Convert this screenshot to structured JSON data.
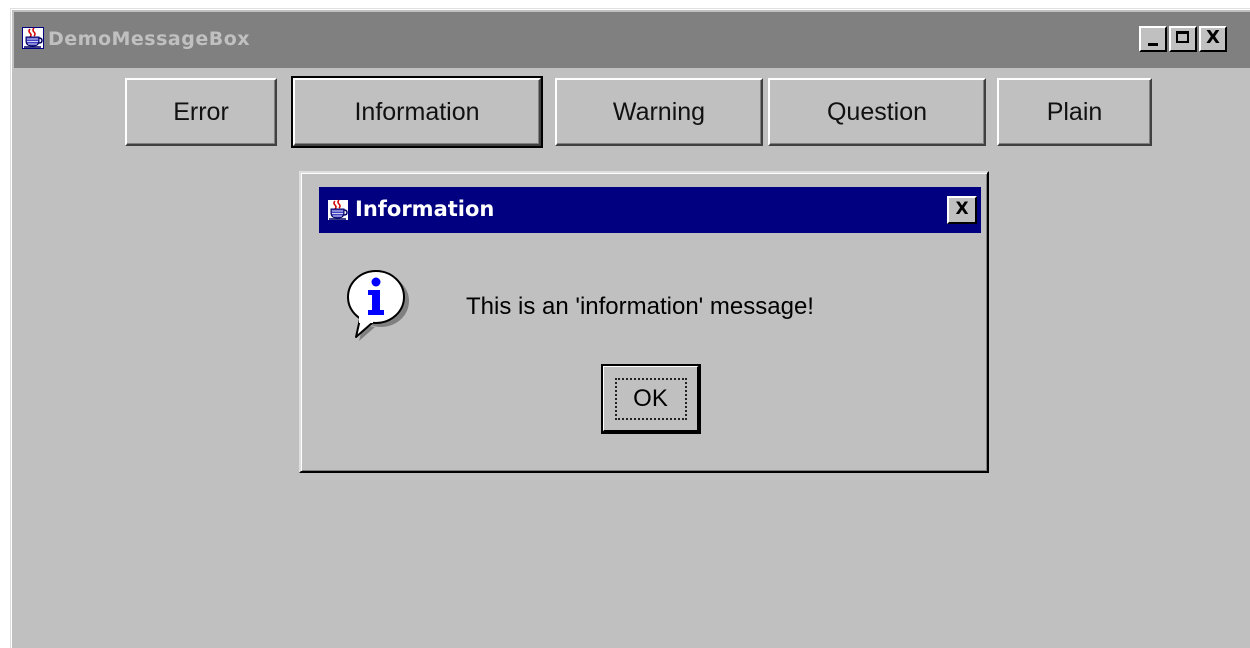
{
  "main_window": {
    "title": "DemoMessageBox",
    "icon": "java-cup-icon",
    "controls": {
      "minimize": "minimize",
      "maximize": "maximize",
      "close": "X"
    }
  },
  "toolbar": {
    "buttons": [
      {
        "label": "Error"
      },
      {
        "label": "Information"
      },
      {
        "label": "Warning"
      },
      {
        "label": "Question"
      },
      {
        "label": "Plain"
      }
    ],
    "focused_button": "Information"
  },
  "dialog": {
    "title": "Information",
    "icon": "java-cup-icon",
    "close_label": "X",
    "message_icon": "info-icon",
    "message": "This is an 'information' message!",
    "ok_label": "OK"
  },
  "colors": {
    "window_bg": "#c0c0c0",
    "inactive_titlebar": "#808080",
    "active_titlebar": "#000080",
    "info_blue": "#0000ff"
  }
}
